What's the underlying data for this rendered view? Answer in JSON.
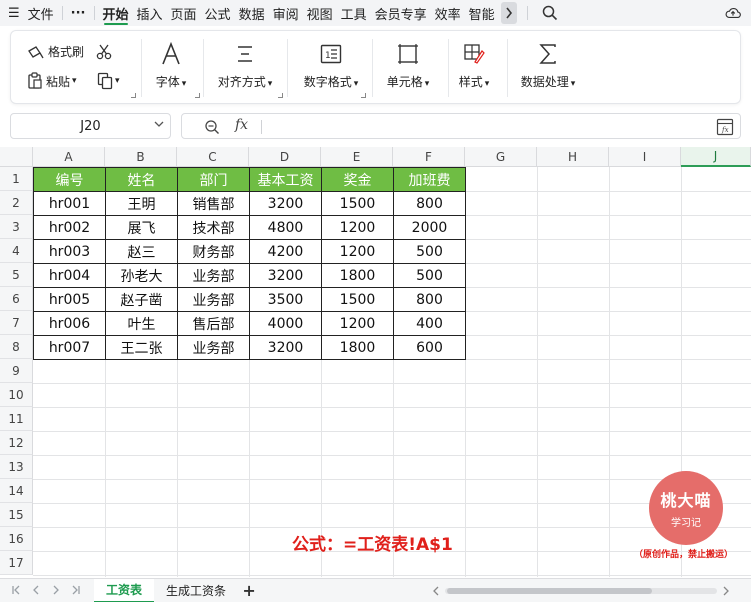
{
  "menubar": {
    "menu_icon": "☰",
    "file": "文件",
    "more": "···",
    "tabs": [
      "开始",
      "插入",
      "页面",
      "公式",
      "数据",
      "审阅",
      "视图",
      "工具",
      "会员专享",
      "效率",
      "智能"
    ],
    "active_tab": "开始"
  },
  "ribbon": {
    "format_painter": "格式刷",
    "paste": "粘贴",
    "font": "字体",
    "align": "对齐方式",
    "number_format": "数字格式",
    "cell": "单元格",
    "style": "样式",
    "data_process": "数据处理"
  },
  "formula_bar": {
    "cell_ref": "J20",
    "fx": "fx",
    "value": ""
  },
  "grid": {
    "columns": [
      "A",
      "B",
      "C",
      "D",
      "E",
      "F",
      "G",
      "H",
      "I",
      "J"
    ],
    "selected_column": "J",
    "rows": [
      "1",
      "2",
      "3",
      "4",
      "5",
      "6",
      "7",
      "8",
      "9",
      "10",
      "11",
      "12",
      "13",
      "14",
      "15",
      "16",
      "17"
    ]
  },
  "table": {
    "headers": [
      "编号",
      "姓名",
      "部门",
      "基本工资",
      "奖金",
      "加班费"
    ],
    "rows": [
      [
        "hr001",
        "王明",
        "销售部",
        "3200",
        "1500",
        "800"
      ],
      [
        "hr002",
        "展飞",
        "技术部",
        "4800",
        "1200",
        "2000"
      ],
      [
        "hr003",
        "赵三",
        "财务部",
        "4200",
        "1200",
        "500"
      ],
      [
        "hr004",
        "孙老大",
        "业务部",
        "3200",
        "1800",
        "500"
      ],
      [
        "hr005",
        "赵子凿",
        "业务部",
        "3500",
        "1500",
        "800"
      ],
      [
        "hr006",
        "叶生",
        "售后部",
        "4000",
        "1200",
        "400"
      ],
      [
        "hr007",
        "王二张",
        "业务部",
        "3200",
        "1800",
        "600"
      ]
    ],
    "header_color": "#6fbd44"
  },
  "annotation": {
    "formula_text": "公式：=工资表!A$1",
    "color": "#e0201b"
  },
  "watermark": {
    "line1": "桃大喵",
    "line2": "学习记",
    "note": "（原创作品，禁止搬运）"
  },
  "sheets": {
    "tabs": [
      "工资表",
      "生成工资条"
    ],
    "active": "工资表",
    "add": "+"
  },
  "colors": {
    "accent": "#1e9b4f",
    "table_header": "#6fbd44",
    "watermark": "#e56d6a"
  }
}
